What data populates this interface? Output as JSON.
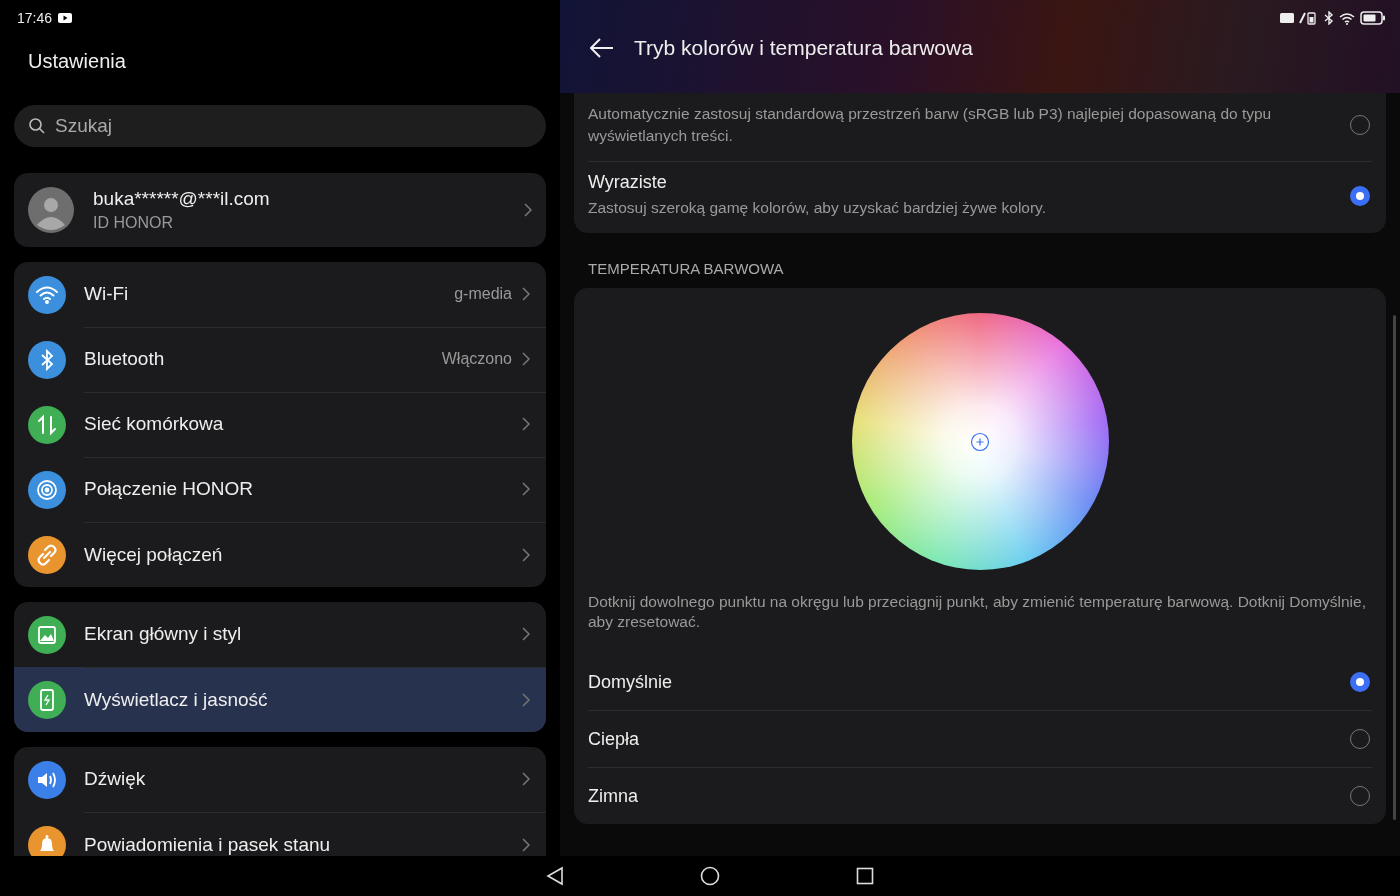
{
  "status_bar": {
    "time": "17:46"
  },
  "sidebar": {
    "title": "Ustawienia",
    "search": {
      "placeholder": "Szukaj"
    },
    "account": {
      "name": "buka******@***il.com",
      "subtitle": "ID HONOR"
    },
    "groups": [
      {
        "items": [
          {
            "label": "Wi-Fi",
            "value": "g-media",
            "kind": "wifi",
            "color": "#3b8fdc",
            "selected": false
          },
          {
            "label": "Bluetooth",
            "value": "Włączono",
            "kind": "bluetooth",
            "color": "#3b8fdc",
            "selected": false
          },
          {
            "label": "Sieć komórkowa",
            "kind": "cellular",
            "color": "#3fae55",
            "selected": false
          },
          {
            "label": "Połączenie HONOR",
            "kind": "rings",
            "color": "#3b8fdc",
            "selected": false
          },
          {
            "label": "Więcej połączeń",
            "kind": "link",
            "color": "#e8952f",
            "selected": false
          }
        ]
      },
      {
        "items": [
          {
            "label": "Ekran główny i styl",
            "kind": "image",
            "color": "#3fae55",
            "selected": false
          },
          {
            "label": "Wyświetlacz i jasność",
            "kind": "phone",
            "color": "#3fae55",
            "selected": true
          }
        ]
      },
      {
        "items": [
          {
            "label": "Dźwięk",
            "kind": "speaker",
            "color": "#3b7fe8",
            "selected": false
          },
          {
            "label": "Powiadomienia i pasek stanu",
            "kind": "bell",
            "color": "#e8952f",
            "selected": false
          }
        ]
      }
    ]
  },
  "detail": {
    "title": "Tryb kolorów i temperatura barwowa",
    "color_modes": [
      {
        "description": "Automatycznie zastosuj standardową przestrzeń barw (sRGB lub P3) najlepiej dopasowaną do typu wyświetlanych treści.",
        "selected": false
      },
      {
        "title": "Wyraziste",
        "description": "Zastosuj szeroką gamę kolorów, aby uzyskać bardziej żywe kolory.",
        "selected": true
      }
    ],
    "temperature_heading": "TEMPERATURA BARWOWA",
    "hint": "Dotknij dowolnego punktu na okręgu lub przeciągnij punkt, aby zmienić temperaturę barwową. Dotknij Domyślnie, aby zresetować.",
    "temperature_options": [
      {
        "label": "Domyślnie",
        "selected": true
      },
      {
        "label": "Ciepła",
        "selected": false
      },
      {
        "label": "Zimna",
        "selected": false
      }
    ]
  }
}
